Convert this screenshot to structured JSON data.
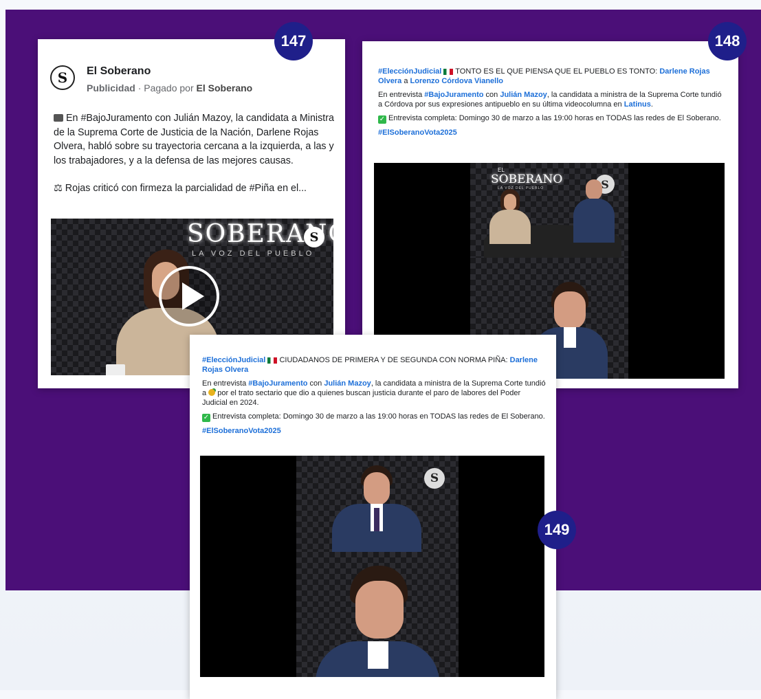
{
  "badges": [
    "147",
    "148",
    "149"
  ],
  "card147": {
    "page_name": "El Soberano",
    "avatar_letter": "S",
    "sponsored": "Publicidad",
    "paid_by_prefix": "· Pagado por",
    "paid_by": "El Soberano",
    "body_p1": "En #BajoJuramento con Julián Mazoy, la candidata a Ministra de la Suprema Corte de Justicia de la Nación, Darlene Rojas Olvera, habló sobre su trayectoria cercana a la izquierda, a las y los trabajadores, y a la defensa de las mejores causas.",
    "body_p2": "⚖ Rojas criticó con firmeza la parcialidad de #Piña en el...",
    "video_brand": "SOBERANO",
    "video_tagline": "LA VOZ DEL PUEBLO",
    "video_logo_letter": "S"
  },
  "card148": {
    "hashtag": "#ElecciónJudicial",
    "headline": "TONTO ES EL QUE PIENSA QUE EL PUEBLO ES TONTO:",
    "name1": "Darlene Rojas Olvera",
    "a": "a",
    "name2": "Lorenzo Córdova Vianello",
    "p2_a": "En entrevista",
    "p2_tag": "#BajoJuramento",
    "p2_con": "con",
    "p2_host": "Julián Mazoy",
    "p2_b": ", la candidata a ministra de la Suprema Corte tundió a Córdova por sus expresiones antipueblo en su última videocolumna en",
    "p2_link": "Latinus",
    "p2_end": ".",
    "p3": "Entrevista completa: Domingo 30 de marzo a las 19:00 horas en TODAS las redes de El Soberano.",
    "footer_tag": "#ElSoberanoVota2025",
    "video_brand": "SOBERANO",
    "video_pre": "EL",
    "video_tagline": "LA VOZ DEL PUEBLO",
    "video_logo_letter": "S"
  },
  "card149": {
    "hashtag": "#ElecciónJudicial",
    "headline": "CIUDADANOS DE PRIMERA Y DE SEGUNDA CON NORMA PIÑA:",
    "name1": "Darlene Rojas Olvera",
    "p2_a": "En entrevista",
    "p2_tag": "#BajoJuramento",
    "p2_con": "con",
    "p2_host": "Julián Mazoy",
    "p2_b": ", la candidata a ministra de la Suprema Corte tundió a",
    "p2_c": "por el trato sectario que dio a quienes buscan justicia durante el paro de labores del Poder Judicial en 2024.",
    "p3": "Entrevista completa: Domingo 30 de marzo a las 19:00 horas en TODAS las redes de El Soberano.",
    "footer_tag": "#ElSoberanoVota2025",
    "video_logo_letter": "S"
  },
  "colors": {
    "purple": "#4b0f78",
    "badge": "#1f1f8a",
    "link": "#1d6fd8"
  }
}
